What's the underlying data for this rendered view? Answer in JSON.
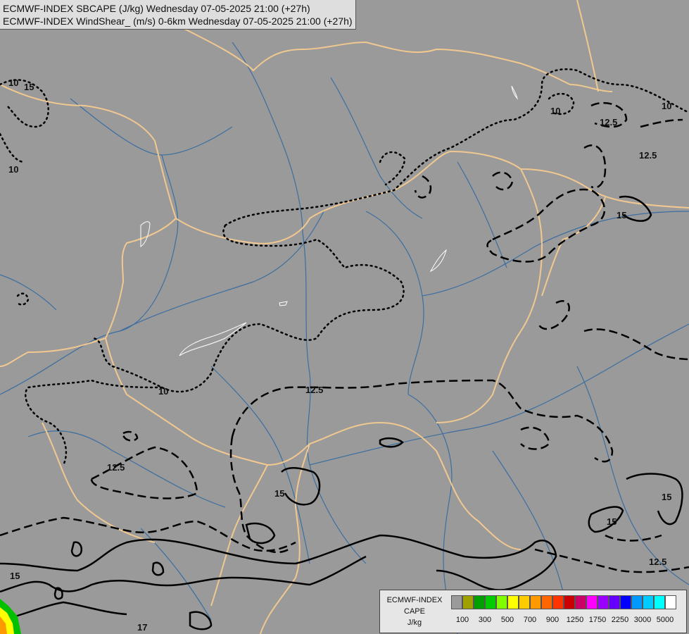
{
  "header": {
    "line1": "ECMWF-INDEX SBCAPE (J/kg) Wednesday 07-05-2025 21:00 (+27h)",
    "line2": "ECMWF-INDEX WindShear_ (m/s) 0-6km Wednesday 07-05-2025 21:00 (+27h)"
  },
  "legend": {
    "title": [
      "ECMWF-INDEX",
      "CAPE",
      "J/kg"
    ],
    "swatch_colors": [
      "#9a9a9a",
      "#a0a000",
      "#00a000",
      "#00cc00",
      "#80ff00",
      "#ffff00",
      "#ffcc00",
      "#ff9900",
      "#ff6600",
      "#ff3300",
      "#cc0000",
      "#cc0066",
      "#ff00ff",
      "#9900ff",
      "#6600ff",
      "#0000ff",
      "#0099ff",
      "#00ccff",
      "#00ffff",
      "#ffffff"
    ],
    "tick_labels": [
      "100",
      "300",
      "500",
      "700",
      "900",
      "1250",
      "1750",
      "2250",
      "3000",
      "5000"
    ]
  },
  "contour_labels": [
    "10",
    "10",
    "10",
    "12.5",
    "12.5",
    "15",
    "10",
    "12.5",
    "12.5",
    "15",
    "15",
    "15",
    "12.5",
    "15",
    "17",
    "10",
    "15"
  ],
  "colors": {
    "background": "#9a9a9a",
    "border": "#f0c890",
    "river": "#3c6ea0",
    "lake_outline": "#ffffff",
    "contour": "#000000"
  }
}
